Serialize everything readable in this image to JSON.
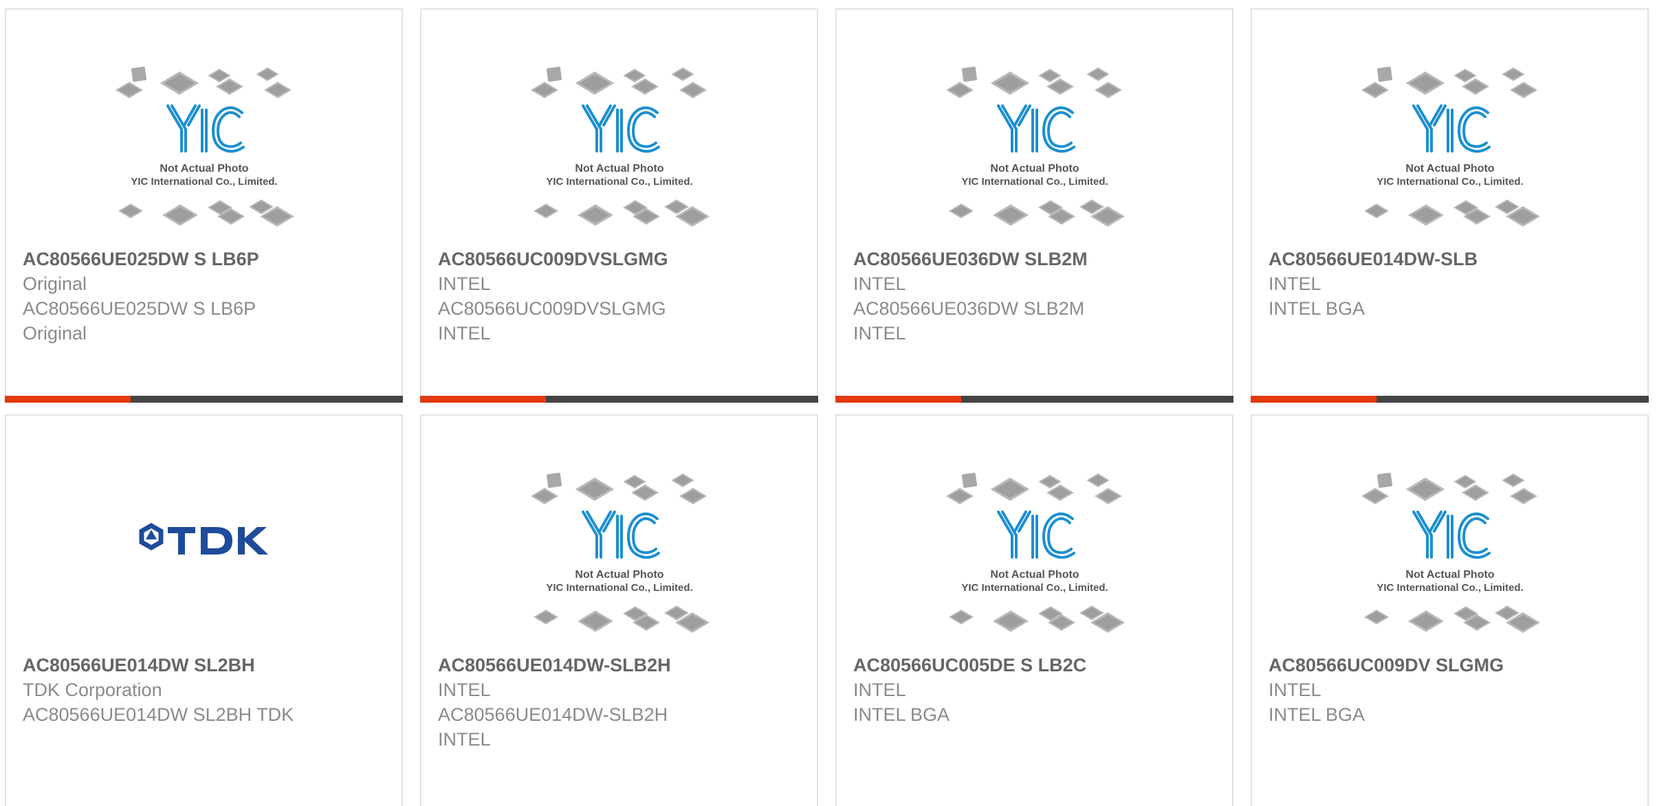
{
  "colors": {
    "accent": "#e33a12",
    "bar_dark": "#444444",
    "title": "#666666",
    "text": "#8a8a8a",
    "yic_blue": "#1b8fd0",
    "tdk_blue": "#1e4b9a"
  },
  "placeholder_image": {
    "icon": "yic-placeholder-icon",
    "caption_line1": "Not Actual Photo",
    "caption_line2": "YIC International Co., Limited.",
    "logo_text": "YIC"
  },
  "tdk_logo": {
    "icon": "tdk-logo-icon",
    "text": "TDK"
  },
  "products": [
    {
      "title": "AC80566UE025DW S LB6P",
      "lines": [
        "Original",
        "AC80566UE025DW S LB6P",
        "Original"
      ],
      "image": "yic"
    },
    {
      "title": "AC80566UC009DVSLGMG",
      "lines": [
        "INTEL",
        "AC80566UC009DVSLGMG",
        "INTEL"
      ],
      "image": "yic"
    },
    {
      "title": "AC80566UE036DW SLB2M",
      "lines": [
        "INTEL",
        "AC80566UE036DW SLB2M",
        "INTEL"
      ],
      "image": "yic"
    },
    {
      "title": "AC80566UE014DW-SLB",
      "lines": [
        "INTEL",
        "INTEL BGA"
      ],
      "image": "yic"
    },
    {
      "title": "AC80566UE014DW SL2BH",
      "lines": [
        "TDK Corporation",
        "AC80566UE014DW SL2BH TDK"
      ],
      "image": "tdk"
    },
    {
      "title": "AC80566UE014DW-SLB2H",
      "lines": [
        "INTEL",
        "AC80566UE014DW-SLB2H",
        "INTEL"
      ],
      "image": "yic"
    },
    {
      "title": "AC80566UC005DE S LB2C",
      "lines": [
        "INTEL",
        "INTEL BGA"
      ],
      "image": "yic"
    },
    {
      "title": "AC80566UC009DV SLGMG",
      "lines": [
        "INTEL",
        "INTEL BGA"
      ],
      "image": "yic"
    }
  ]
}
